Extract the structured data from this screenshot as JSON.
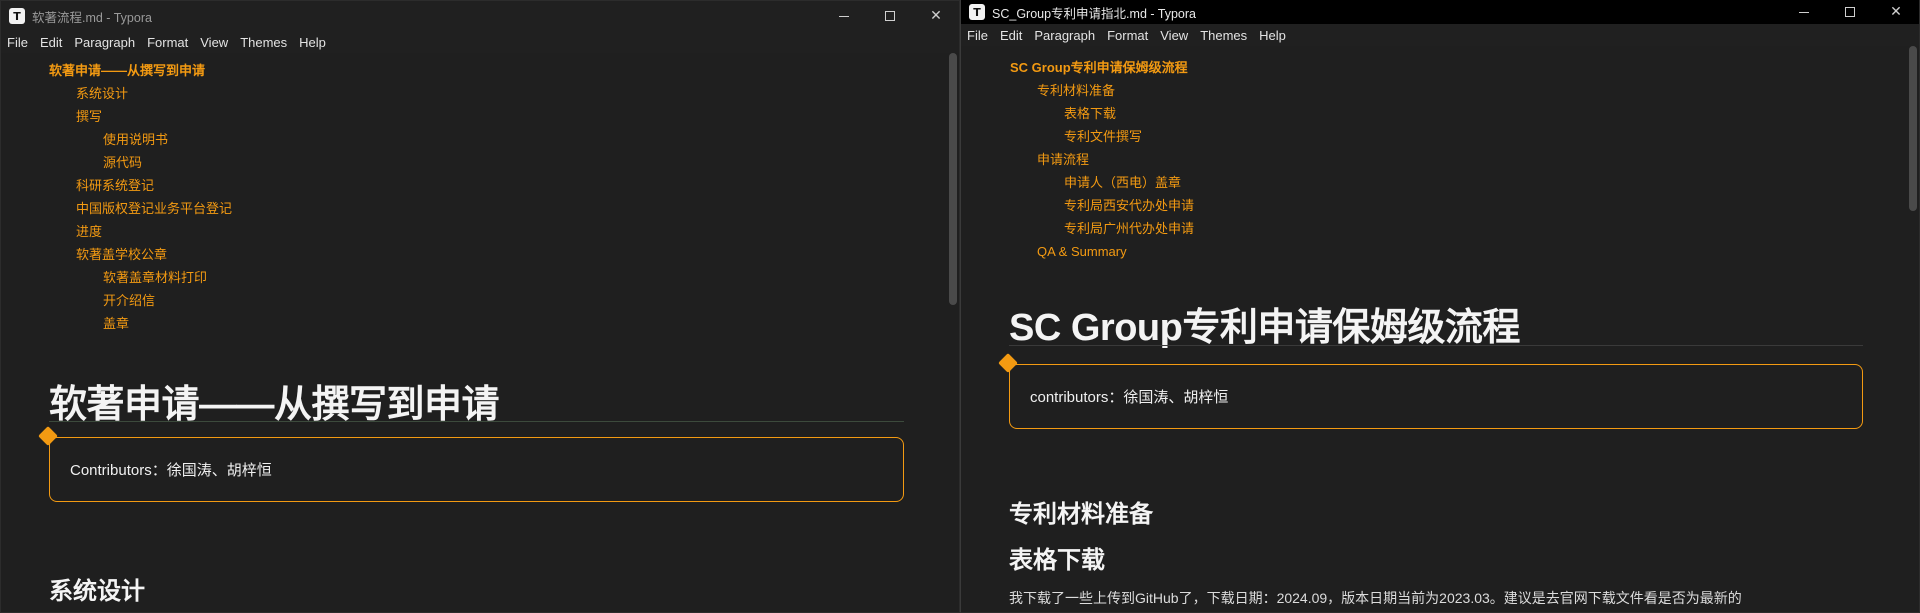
{
  "left": {
    "title": "软著流程.md - Typora",
    "menu": [
      "File",
      "Edit",
      "Paragraph",
      "Format",
      "View",
      "Themes",
      "Help"
    ],
    "toc": [
      {
        "label": "软著申请——从撰写到申请",
        "level": 1
      },
      {
        "label": "系统设计",
        "level": 2
      },
      {
        "label": "撰写",
        "level": 2
      },
      {
        "label": "使用说明书",
        "level": 3
      },
      {
        "label": "源代码",
        "level": 3
      },
      {
        "label": "科研系统登记",
        "level": 2
      },
      {
        "label": "中国版权登记业务平台登记",
        "level": 2
      },
      {
        "label": "进度",
        "level": 2
      },
      {
        "label": "软著盖学校公章",
        "level": 2
      },
      {
        "label": "软著盖章材料打印",
        "level": 3
      },
      {
        "label": "开介绍信",
        "level": 3
      },
      {
        "label": "盖章",
        "level": 3
      }
    ],
    "h1": "软著申请——从撰写到申请",
    "callout": "Contributors：徐国涛、胡梓恒",
    "h2": "系统设计"
  },
  "right": {
    "title": "SC_Group专利申请指北.md - Typora",
    "menu": [
      "File",
      "Edit",
      "Paragraph",
      "Format",
      "View",
      "Themes",
      "Help"
    ],
    "toc": [
      {
        "label": "SC Group专利申请保姆级流程",
        "level": 1
      },
      {
        "label": "专利材料准备",
        "level": 2
      },
      {
        "label": "表格下载",
        "level": 3
      },
      {
        "label": "专利文件撰写",
        "level": 3
      },
      {
        "label": "申请流程",
        "level": 2
      },
      {
        "label": "申请人（西电）盖章",
        "level": 3
      },
      {
        "label": "专利局西安代办处申请",
        "level": 3
      },
      {
        "label": "专利局广州代办处申请",
        "level": 3
      },
      {
        "label": "QA & Summary",
        "level": 2
      }
    ],
    "h1": "SC Group专利申请保姆级流程",
    "callout": "contributors：徐国涛、胡梓恒",
    "h2a": "专利材料准备",
    "h2b": "表格下载",
    "para": "我下载了一些上传到GitHub了，下载日期：2024.09，版本日期当前为2023.03。建议是去官网下载文件看是否为最新的"
  },
  "colors": {
    "accent": "#f39a12",
    "background": "#1f1f1f"
  },
  "icons": {
    "app": "typora-app-icon",
    "minimize": "minimize-icon",
    "maximize": "maximize-icon",
    "close": "close-icon"
  }
}
